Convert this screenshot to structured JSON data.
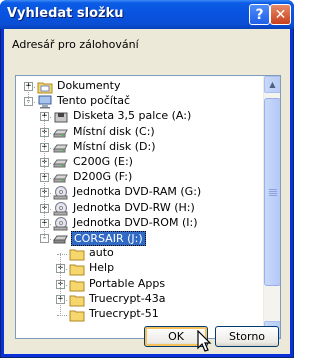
{
  "window": {
    "title": "Vyhledat složku",
    "help_label": "?",
    "close_label": "✕"
  },
  "description": "Adresář pro zálohování",
  "tree": {
    "items": [
      {
        "label": "Dokumenty",
        "icon": "documents-folder-icon",
        "level": 0,
        "expander": "+"
      },
      {
        "label": "Tento počítač",
        "icon": "computer-icon",
        "level": 0,
        "expander": "−"
      },
      {
        "label": "Disketa 3,5 palce (A:)",
        "icon": "floppy-drive-icon",
        "level": 1,
        "expander": "+"
      },
      {
        "label": "Místní disk (C:)",
        "icon": "hard-drive-icon",
        "level": 1,
        "expander": "+"
      },
      {
        "label": "Místní disk (D:)",
        "icon": "hard-drive-icon",
        "level": 1,
        "expander": "+"
      },
      {
        "label": "C200G (E:)",
        "icon": "hard-drive-icon",
        "level": 1,
        "expander": "+"
      },
      {
        "label": "D200G (F:)",
        "icon": "hard-drive-icon",
        "level": 1,
        "expander": "+"
      },
      {
        "label": "Jednotka DVD-RAM (G:)",
        "icon": "dvd-drive-icon",
        "level": 1,
        "expander": "+"
      },
      {
        "label": "Jednotka DVD-RW (H:)",
        "icon": "dvd-drive-icon",
        "level": 1,
        "expander": "+"
      },
      {
        "label": "Jednotka DVD-ROM (I:)",
        "icon": "dvd-drive-icon",
        "level": 1,
        "expander": "+"
      },
      {
        "label": "CORSAIR (J:)",
        "icon": "removable-drive-icon",
        "level": 1,
        "expander": "−",
        "selected": true
      },
      {
        "label": "auto",
        "icon": "folder-icon",
        "level": 2,
        "expander": ""
      },
      {
        "label": "Help",
        "icon": "folder-icon",
        "level": 2,
        "expander": "+"
      },
      {
        "label": "Portable Apps",
        "icon": "folder-icon",
        "level": 2,
        "expander": "+"
      },
      {
        "label": "Truecrypt-43a",
        "icon": "folder-icon",
        "level": 2,
        "expander": "+"
      },
      {
        "label": "Truecrypt-51",
        "icon": "folder-icon",
        "level": 2,
        "expander": ""
      }
    ]
  },
  "buttons": {
    "ok_label": "OK",
    "cancel_label": "Storno"
  },
  "colors": {
    "titlebar": "#0853e0",
    "selection": "#316ac5",
    "dialog_bg": "#ece9d8",
    "folder": "#f5d76e"
  }
}
